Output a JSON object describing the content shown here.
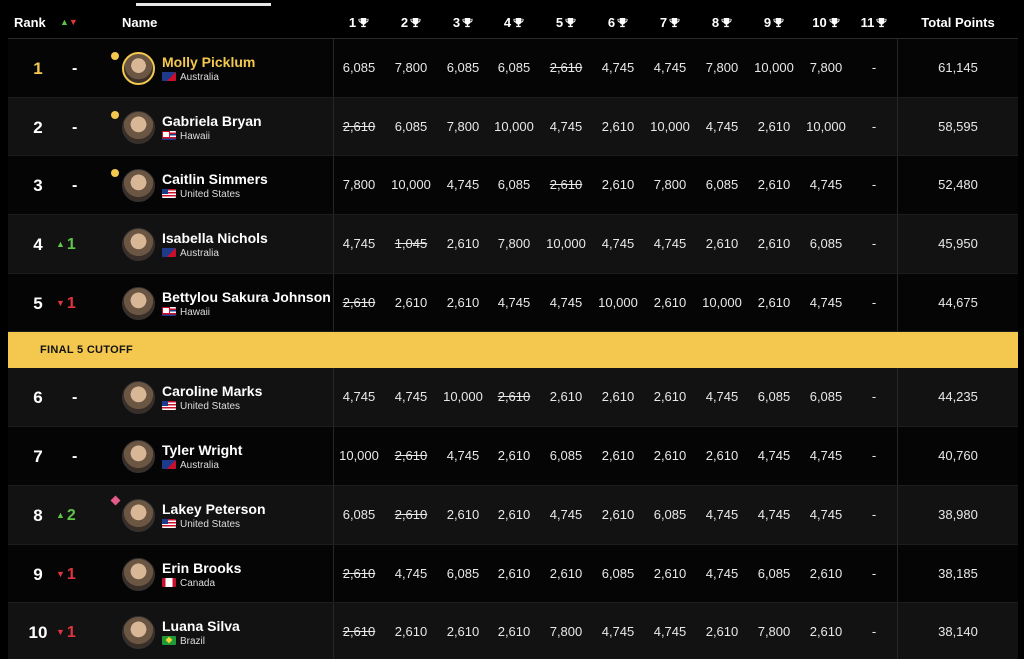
{
  "header": {
    "rank": "Rank",
    "name": "Name",
    "total": "Total Points",
    "events": [
      "1",
      "2",
      "3",
      "4",
      "5",
      "6",
      "7",
      "8",
      "9",
      "10",
      "11"
    ]
  },
  "cutoff_label": "FINAL 5 CUTOFF",
  "rows": [
    {
      "rank": "1",
      "move": "-",
      "move_dir": "none",
      "name": "Molly Picklum",
      "country": "Australia",
      "flag": "au",
      "marker": "dot",
      "leader": true,
      "scores": [
        "6,085",
        "7,800",
        "6,085",
        "6,085",
        "2,610",
        "4,745",
        "4,745",
        "7,800",
        "10,000",
        "7,800",
        "-"
      ],
      "dropped": [
        4
      ],
      "total": "61,145"
    },
    {
      "rank": "2",
      "move": "-",
      "move_dir": "none",
      "name": "Gabriela Bryan",
      "country": "Hawaii",
      "flag": "hi",
      "marker": "dot",
      "leader": false,
      "scores": [
        "2,610",
        "6,085",
        "7,800",
        "10,000",
        "4,745",
        "2,610",
        "10,000",
        "4,745",
        "2,610",
        "10,000",
        "-"
      ],
      "dropped": [
        0
      ],
      "total": "58,595"
    },
    {
      "rank": "3",
      "move": "-",
      "move_dir": "none",
      "name": "Caitlin Simmers",
      "country": "United States",
      "flag": "us",
      "marker": "dot",
      "leader": false,
      "scores": [
        "7,800",
        "10,000",
        "4,745",
        "6,085",
        "2,610",
        "2,610",
        "7,800",
        "6,085",
        "2,610",
        "4,745",
        "-"
      ],
      "dropped": [
        4
      ],
      "total": "52,480"
    },
    {
      "rank": "4",
      "move": "1",
      "move_dir": "up",
      "name": "Isabella Nichols",
      "country": "Australia",
      "flag": "au",
      "marker": "none",
      "leader": false,
      "scores": [
        "4,745",
        "1,045",
        "2,610",
        "7,800",
        "10,000",
        "4,745",
        "4,745",
        "2,610",
        "2,610",
        "6,085",
        "-"
      ],
      "dropped": [
        1
      ],
      "total": "45,950"
    },
    {
      "rank": "5",
      "move": "1",
      "move_dir": "down",
      "name": "Bettylou Sakura Johnson",
      "country": "Hawaii",
      "flag": "hi",
      "marker": "none",
      "leader": false,
      "scores": [
        "2,610",
        "2,610",
        "2,610",
        "4,745",
        "4,745",
        "10,000",
        "2,610",
        "10,000",
        "2,610",
        "4,745",
        "-"
      ],
      "dropped": [
        0
      ],
      "total": "44,675"
    },
    {
      "rank": "6",
      "move": "-",
      "move_dir": "none",
      "name": "Caroline Marks",
      "country": "United States",
      "flag": "us",
      "marker": "none",
      "leader": false,
      "scores": [
        "4,745",
        "4,745",
        "10,000",
        "2,610",
        "2,610",
        "2,610",
        "2,610",
        "4,745",
        "6,085",
        "6,085",
        "-"
      ],
      "dropped": [
        3
      ],
      "total": "44,235"
    },
    {
      "rank": "7",
      "move": "-",
      "move_dir": "none",
      "name": "Tyler Wright",
      "country": "Australia",
      "flag": "au",
      "marker": "none",
      "leader": false,
      "scores": [
        "10,000",
        "2,610",
        "4,745",
        "2,610",
        "6,085",
        "2,610",
        "2,610",
        "2,610",
        "4,745",
        "4,745",
        "-"
      ],
      "dropped": [
        1
      ],
      "total": "40,760"
    },
    {
      "rank": "8",
      "move": "2",
      "move_dir": "up",
      "name": "Lakey Peterson",
      "country": "United States",
      "flag": "us",
      "marker": "diamond",
      "leader": false,
      "scores": [
        "6,085",
        "2,610",
        "2,610",
        "2,610",
        "4,745",
        "2,610",
        "6,085",
        "4,745",
        "4,745",
        "4,745",
        "-"
      ],
      "dropped": [
        1
      ],
      "total": "38,980"
    },
    {
      "rank": "9",
      "move": "1",
      "move_dir": "down",
      "name": "Erin Brooks",
      "country": "Canada",
      "flag": "ca",
      "marker": "none",
      "leader": false,
      "scores": [
        "2,610",
        "4,745",
        "6,085",
        "2,610",
        "2,610",
        "6,085",
        "2,610",
        "4,745",
        "6,085",
        "2,610",
        "-"
      ],
      "dropped": [
        0
      ],
      "total": "38,185"
    },
    {
      "rank": "10",
      "move": "1",
      "move_dir": "down",
      "name": "Luana Silva",
      "country": "Brazil",
      "flag": "br",
      "marker": "none",
      "leader": false,
      "scores": [
        "2,610",
        "2,610",
        "2,610",
        "2,610",
        "7,800",
        "4,745",
        "4,745",
        "2,610",
        "7,800",
        "2,610",
        "-"
      ],
      "dropped": [
        0
      ],
      "total": "38,140"
    }
  ]
}
